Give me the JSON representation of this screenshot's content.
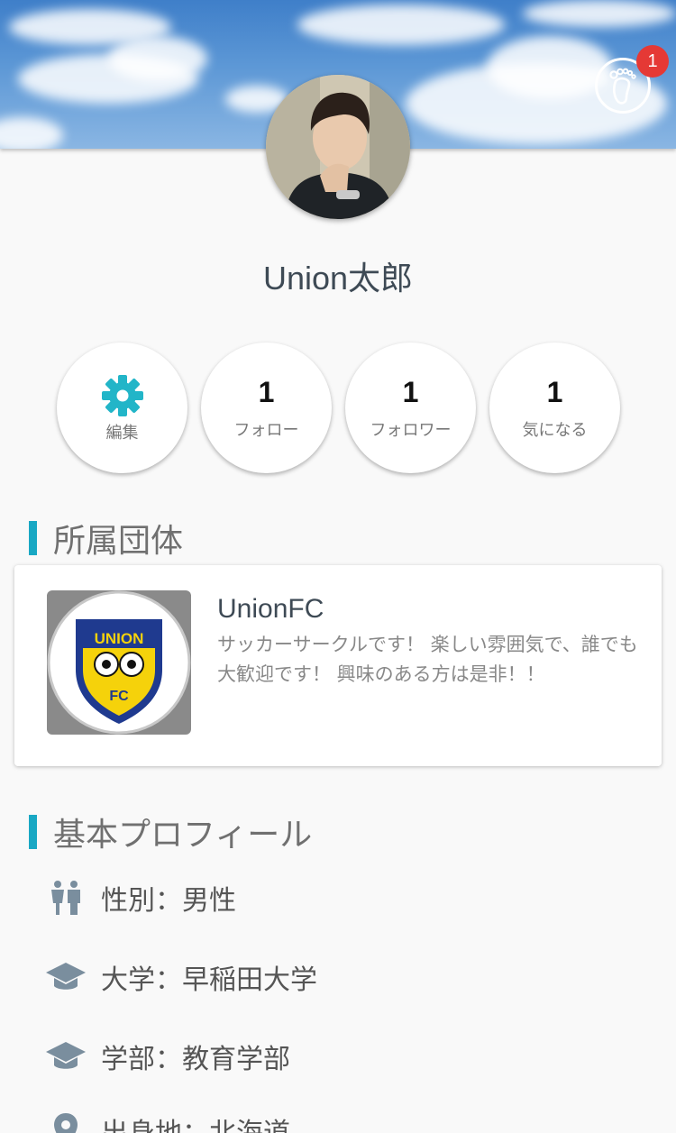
{
  "header": {
    "notification_count": "1"
  },
  "profile": {
    "name": "Union太郎"
  },
  "stats": [
    {
      "label": "編集"
    },
    {
      "count": "1",
      "label": "フォロー"
    },
    {
      "count": "1",
      "label": "フォロワー"
    },
    {
      "count": "1",
      "label": "気になる"
    }
  ],
  "groups_section": {
    "title": "所属団体",
    "group": {
      "name": "UnionFC",
      "description": "サッカーサークルです！ 楽しい雰囲気で、誰でも大歓迎です！ 興味のある方は是非！！",
      "logo_text_top": "UNION",
      "logo_text_bottom": "FC"
    }
  },
  "basic_profile": {
    "title": "基本プロフィール",
    "items": [
      {
        "icon": "gender-icon",
        "text": "性別：男性"
      },
      {
        "icon": "graduation-cap-icon",
        "text": "大学：早稲田大学"
      },
      {
        "icon": "graduation-cap-icon",
        "text": "学部：教育学部"
      },
      {
        "icon": "location-pin-icon",
        "text": "出身地：北海道"
      }
    ]
  },
  "colors": {
    "accent": "#19a8c4",
    "badge": "#e53935",
    "icon_gray": "#7a8e9e"
  }
}
